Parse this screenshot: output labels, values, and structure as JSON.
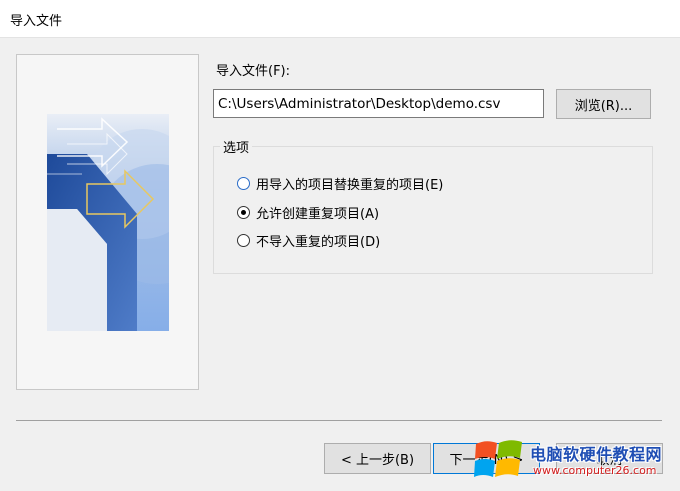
{
  "window": {
    "title": "导入文件"
  },
  "file": {
    "label": "导入文件(F):",
    "path_value": "C:\\Users\\Administrator\\Desktop\\demo.csv",
    "browse_label": "浏览(R)..."
  },
  "options": {
    "legend": "选项",
    "items": [
      {
        "label": "用导入的项目替换重复的项目(E)",
        "selected": false
      },
      {
        "label": "允许创建重复项目(A)",
        "selected": true
      },
      {
        "label": "不导入重复的项目(D)",
        "selected": false
      }
    ]
  },
  "buttons": {
    "back_label": "< 上一步(B)",
    "next_label": "下一步(N) >",
    "cancel_label": "取消"
  },
  "watermark": {
    "title": "电脑软硬件教程网",
    "url": "www.computer26.com"
  },
  "colors": {
    "accent_blue": "#0078d7",
    "art_dark_blue": "#2c5aa8",
    "art_light_blue": "#7fa8e0",
    "art_yellow": "#e8c860"
  },
  "icons": {
    "wizard_art": "import-wizard-arrow-graphic",
    "watermark_logo": "windows-logo"
  }
}
